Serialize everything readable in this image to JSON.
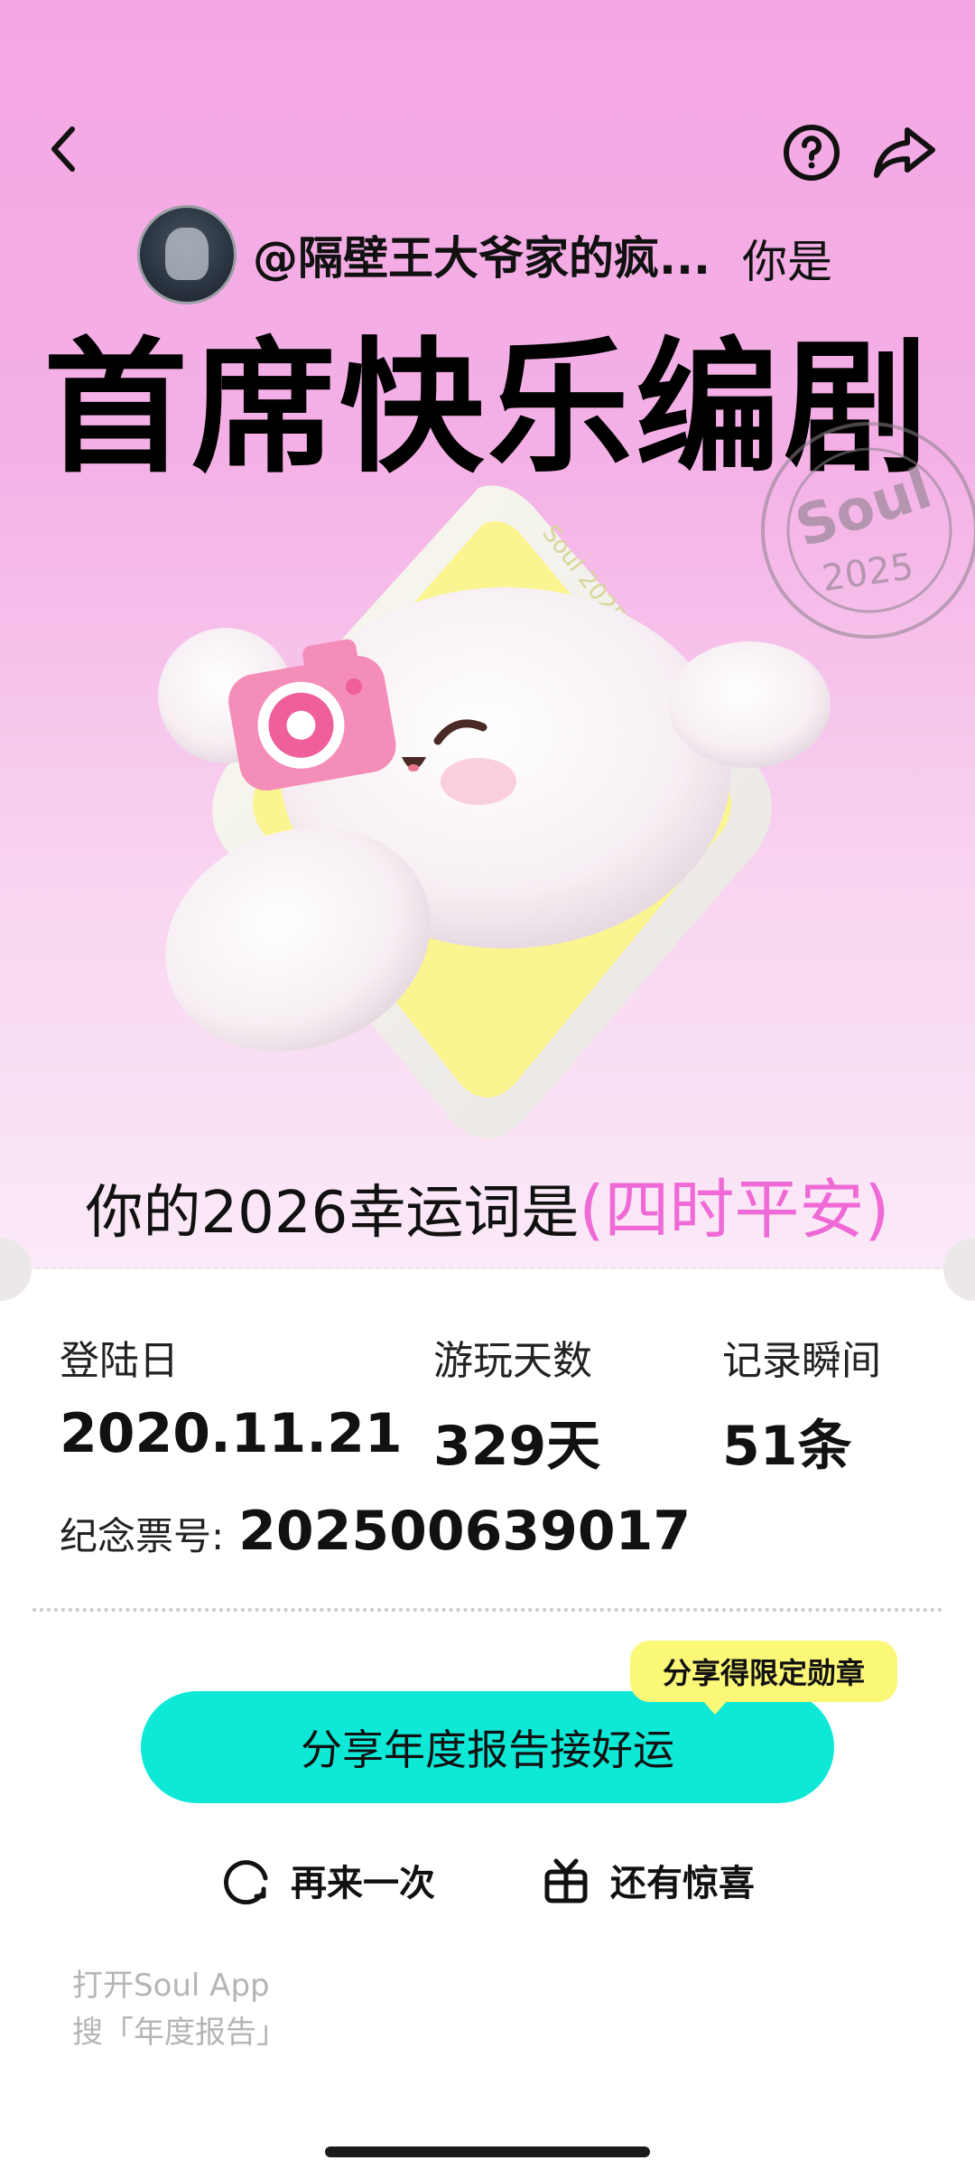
{
  "header": {
    "back_icon": "chevron-left-icon",
    "help_icon": "question-circle-icon",
    "share_icon": "share-arrow-icon"
  },
  "user": {
    "name": "@隔壁王大爷家的疯...",
    "you_are": "你是"
  },
  "title": "首席快乐编剧",
  "stamp": {
    "brand": "Soul",
    "year": "2025"
  },
  "mascot": {
    "badge_text": "Soul 2025"
  },
  "lucky_word": {
    "prefix": "你的2026幸运词是",
    "word": "(四时平安)"
  },
  "stats": [
    {
      "label": "登陆日",
      "value": "2020.11.21"
    },
    {
      "label": "游玩天数",
      "value": "329天"
    },
    {
      "label": "记录瞬间",
      "value": "51条"
    }
  ],
  "ticket": {
    "label": "纪念票号:",
    "number": "202500639017"
  },
  "tooltip": "分享得限定勋章",
  "share_button": "分享年度报告接好运",
  "actions": {
    "again": "再来一次",
    "surprise": "还有惊喜"
  },
  "footer": {
    "line1": "打开Soul App",
    "line2": "搜「年度报告」"
  },
  "colors": {
    "hero_pink": "#f4a7e3",
    "accent_pink": "#ef6ad6",
    "button_cyan": "#0ee8d6",
    "tooltip_yellow": "#fbf777"
  }
}
